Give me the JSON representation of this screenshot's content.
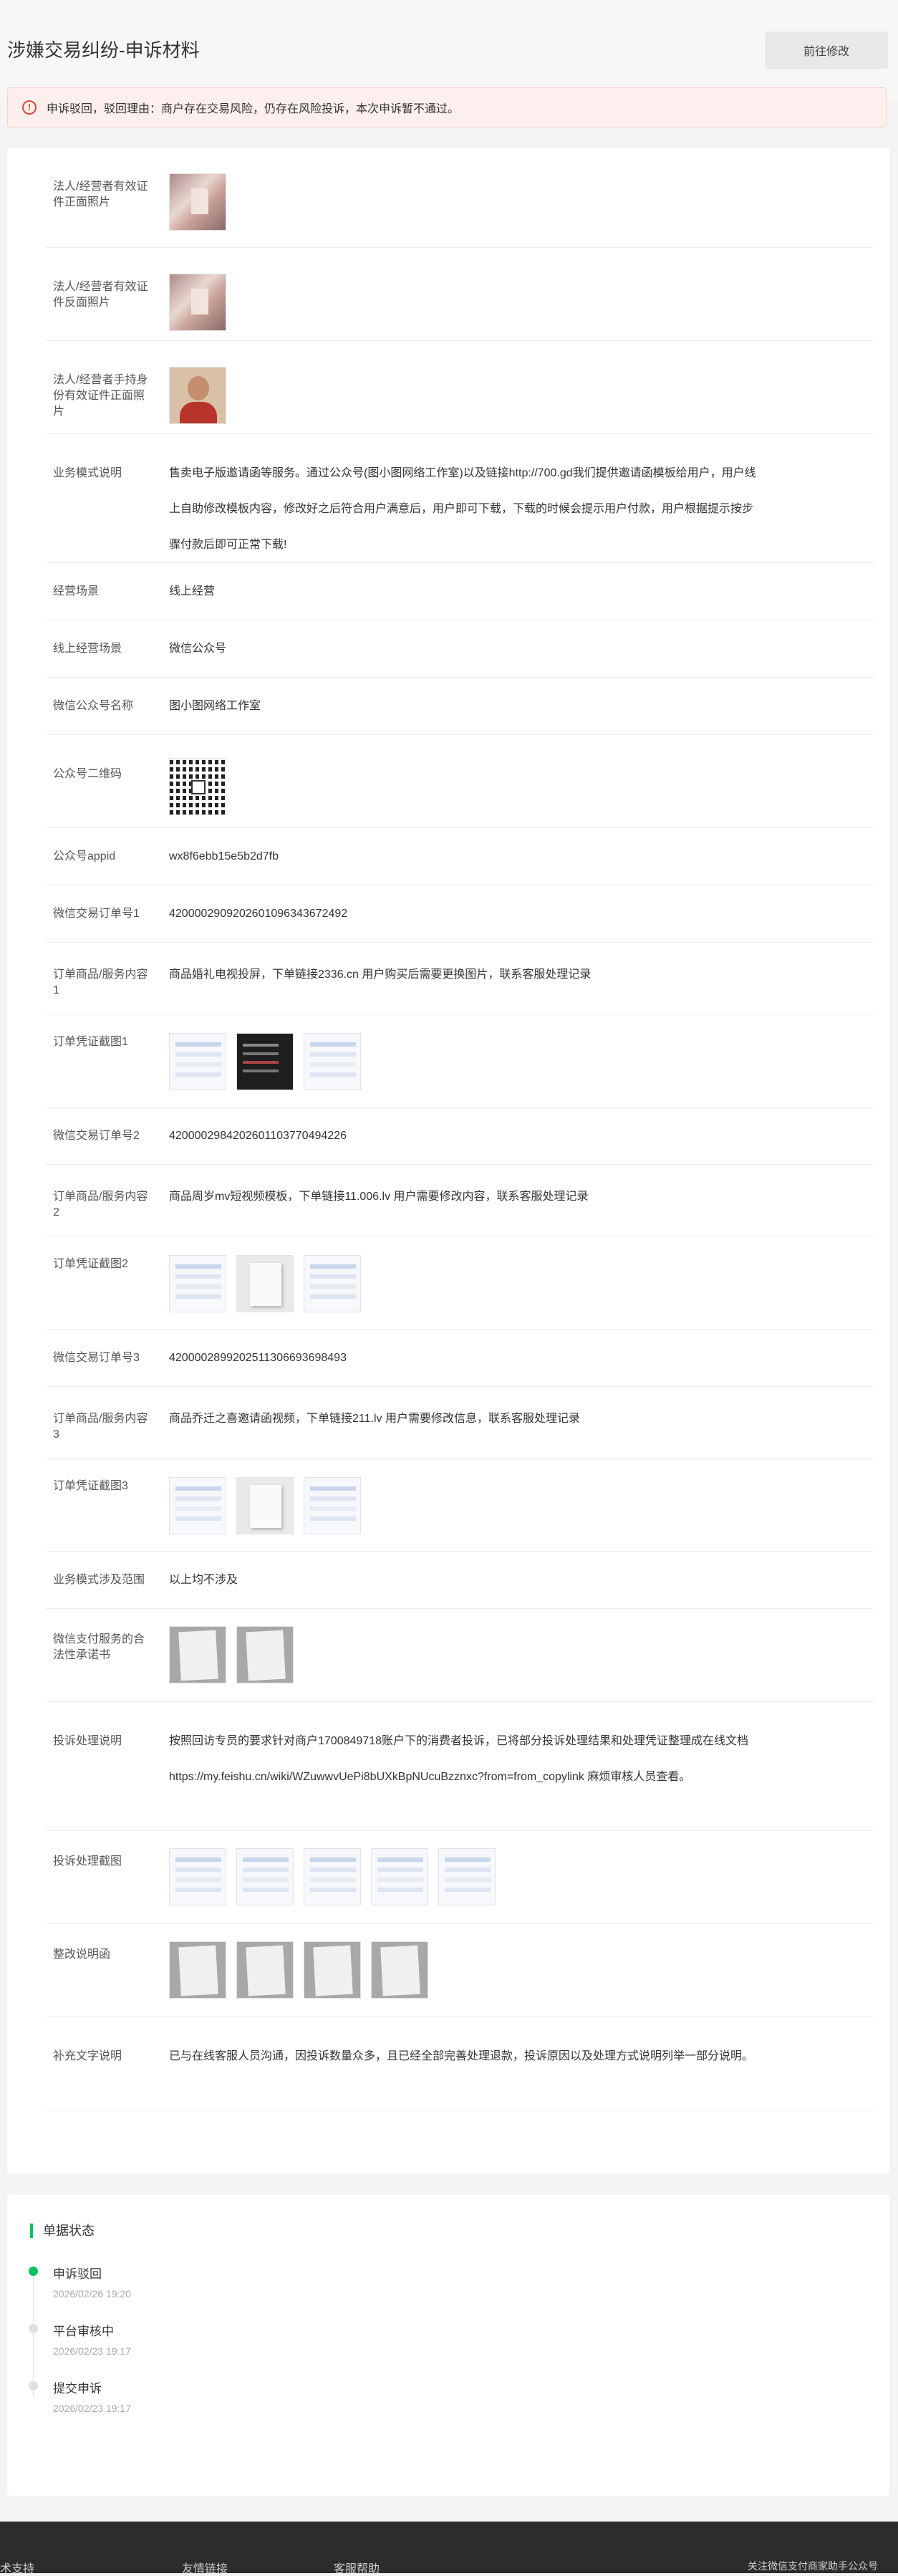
{
  "header": {
    "title": "涉嫌交易纠纷-申诉材料",
    "action_label": "前往修改"
  },
  "alert": {
    "icon": "warning-circle-icon",
    "text": "申诉驳回，驳回理由：商户存在交易风险，仍存在风险投诉，本次申诉暂不通过。",
    "color": "#e04b3b"
  },
  "fields": {
    "id_front_label": "法人/经营者有效证件正面照片",
    "id_back_label": "法人/经营者有效证件反面照片",
    "id_hand_label": "法人/经营者手持身份有效证件正面照片",
    "biz_model_label": "业务模式说明",
    "biz_model_value": "售卖电子版邀请函等服务。通过公众号(图小图网络工作室)以及链接http://700.gd我们提供邀请函模板给用户，用户线上自助修改模板内容，修改好之后符合用户满意后，用户即可下载，下载的时候会提示用户付款，用户根据提示按步骤付款后即可正常下载!",
    "scene_label": "经营场景",
    "scene_value": "线上经营",
    "online_scene_label": "线上经营场景",
    "online_scene_value": "微信公众号",
    "mp_name_label": "微信公众号名称",
    "mp_name_value": "图小图网络工作室",
    "mp_qr_label": "公众号二维码",
    "appid_label": "公众号appid",
    "appid_value": "wx8f6ebb15e5b2d7fb",
    "order1_label": "微信交易订单号1",
    "order1_value": "4200002909202601096343672492",
    "goods1_label": "订单商品/服务内容1",
    "goods1_value": "商品婚礼电视投屏，下单链接2336.cn 用户购买后需要更换图片，联系客服处理记录",
    "voucher1_label": "订单凭证截图1",
    "order2_label": "微信交易订单号2",
    "order2_value": "4200002984202601103770494226",
    "goods2_label": "订单商品/服务内容2",
    "goods2_value": "商品周岁mv短视频模板，下单链接11.006.lv 用户需要修改内容，联系客服处理记录",
    "voucher2_label": "订单凭证截图2",
    "order3_label": "微信交易订单号3",
    "order3_value": "4200002899202511306693698493",
    "goods3_label": "订单商品/服务内容3",
    "goods3_value": "商品乔迁之喜邀请函视频，下单链接211.lv 用户需要修改信息，联系客服处理记录",
    "voucher3_label": "订单凭证截图3",
    "scope_label": "业务模式涉及范围",
    "scope_value": "以上均不涉及",
    "promise_label": "微信支付服务的合法性承诺书",
    "complaint_label": "投诉处理说明",
    "complaint_value": "按照回访专员的要求针对商户1700849718账户下的消费者投诉，已将部分投诉处理结果和处理凭证整理成在线文档 https://my.feishu.cn/wiki/WZuwwvUePi8bUXkBpNUcuBzznxc?from=from_copylink 麻烦审核人员查看。",
    "complaint_shots_label": "投诉处理截图",
    "rectify_label": "整改说明函",
    "extra_label": "补充文字说明",
    "extra_value": "已与在线客服人员沟通，因投诉数量众多，且已经全部完善处理退款，投诉原因以及处理方式说明列举一部分说明。"
  },
  "status": {
    "title": "单据状态",
    "accent": "#07c160",
    "steps": [
      {
        "label": "申诉驳回",
        "time": "2026/02/26 19:20",
        "active": true
      },
      {
        "label": "平台审核中",
        "time": "2026/02/23 19:17",
        "active": false
      },
      {
        "label": "提交申诉",
        "time": "2026/02/23 19:17",
        "active": false
      }
    ]
  },
  "footer": {
    "links": [
      "技术支持",
      "友情链接",
      "客服帮助",
      "关注微信支付商家助手公众号"
    ]
  }
}
